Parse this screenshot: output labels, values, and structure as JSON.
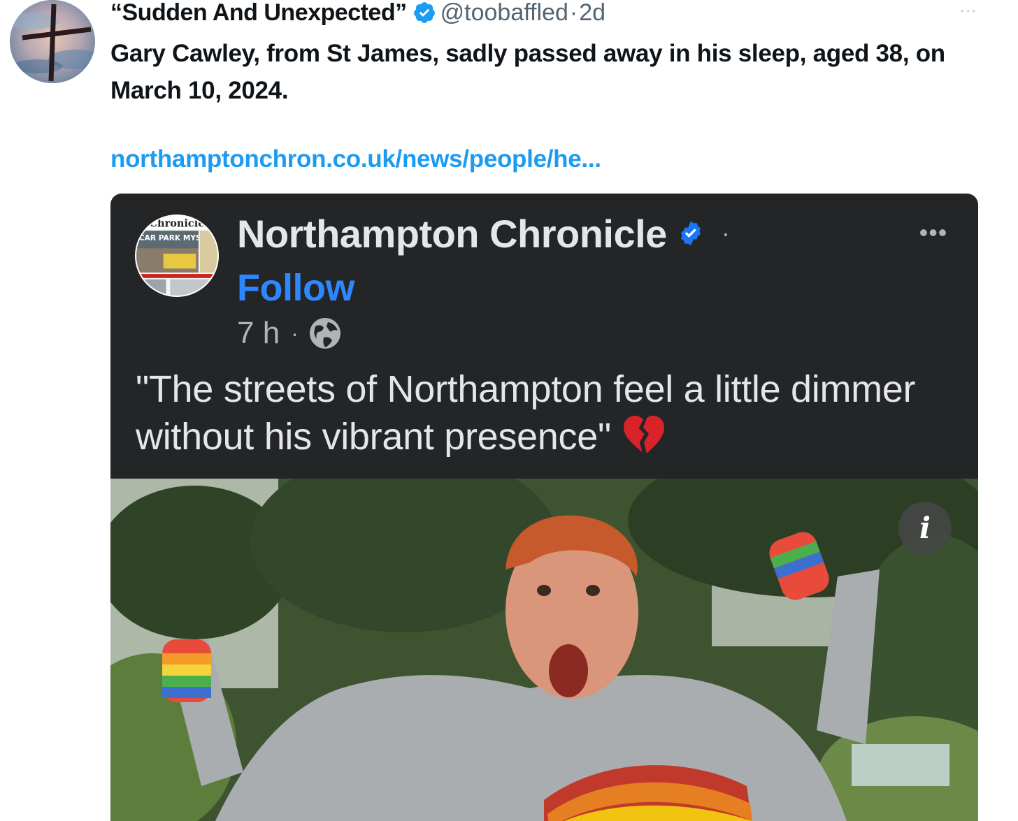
{
  "tweet": {
    "display_name": "“Sudden And Unexpected”",
    "handle": "@toobaffled",
    "separator": "·",
    "time": "2d",
    "more": "···",
    "text": "Gary Cawley, from St James, sadly passed away in his sleep, aged 38, on March 10, 2024.",
    "link": "northamptonchron.co.uk/news/people/he...",
    "avatar_icon": "cross-icon",
    "colors": {
      "link": "#1d9bf0",
      "verified": "#1d9bf0"
    }
  },
  "embedded_post": {
    "page_name": "Northampton Chronicle",
    "dot": "·",
    "more": "•••",
    "follow_label": "Follow",
    "time": "7 h",
    "meta_dot": "·",
    "audience_icon": "globe-icon",
    "caption": "\"The streets of Northampton feel a little dimmer without his vibrant presence\"",
    "emoji_icon": "broken-heart-icon",
    "info_label": "i",
    "avatar_masthead_text": "Chronicle",
    "avatar_headline_text": "CAR PARK MYSTERY",
    "colors": {
      "background": "#242526",
      "follow": "#2d88ff",
      "verified": "#1877f2"
    }
  }
}
